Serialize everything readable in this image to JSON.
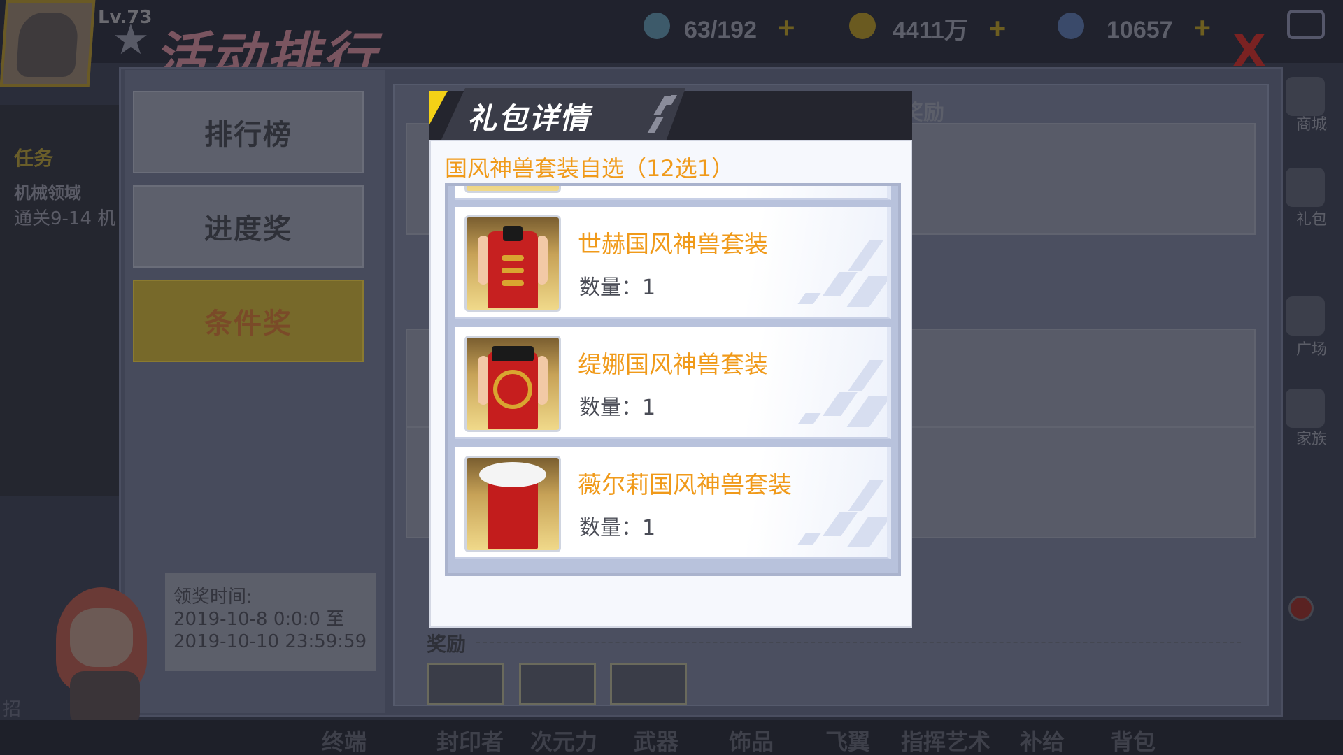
{
  "header": {
    "level": "Lv.73",
    "title": "活动排行",
    "resources": [
      {
        "icon": "energy-icon",
        "value": "63/192"
      },
      {
        "icon": "gold-coin-icon",
        "value": "4411万"
      },
      {
        "icon": "diamond-icon",
        "value": "10657"
      }
    ],
    "plus": "+",
    "close": "X"
  },
  "left_hud": {
    "task": "任务",
    "area": "机械领域",
    "stage": "通关9-14 机"
  },
  "side_tabs": [
    {
      "label": "排行榜"
    },
    {
      "label": "进度奖"
    },
    {
      "label": "条件奖"
    }
  ],
  "claim_time": {
    "label": "领奖时间:",
    "start": "2019-10-8 0:0:0 至",
    "end": "2019-10-10 23:59:59"
  },
  "background_content": {
    "reward_label": "奖励",
    "reward_top_label": "奖励"
  },
  "right_hud": {
    "shop": "商城",
    "gift": "礼包",
    "plaza": "广场",
    "family": "家族"
  },
  "bottom_nav": [
    "封印者",
    "次元力",
    "武器",
    "饰品",
    "飞翼",
    "指挥艺术",
    "补给",
    "背包"
  ],
  "chat": {
    "line1": "招",
    "line2": "招",
    "line3": "终端"
  },
  "popup": {
    "title": "礼包详情",
    "subtitle": "国风神兽套装自选（12选1）",
    "qty_label": "数量：",
    "items": [
      {
        "name": "世赫国风神兽套装",
        "quantity": "1",
        "icon": "red-sleeveless-qipao-outfit-icon"
      },
      {
        "name": "缇娜国风神兽套装",
        "quantity": "1",
        "icon": "red-dragon-qipao-outfit-icon"
      },
      {
        "name": "薇尔莉国风神兽套装",
        "quantity": "1",
        "icon": "red-fur-collar-qipao-outfit-icon"
      }
    ]
  },
  "colors": {
    "accent_yellow": "#f4d116",
    "item_name_orange": "#f09a1a",
    "popup_header": "#24252e"
  }
}
